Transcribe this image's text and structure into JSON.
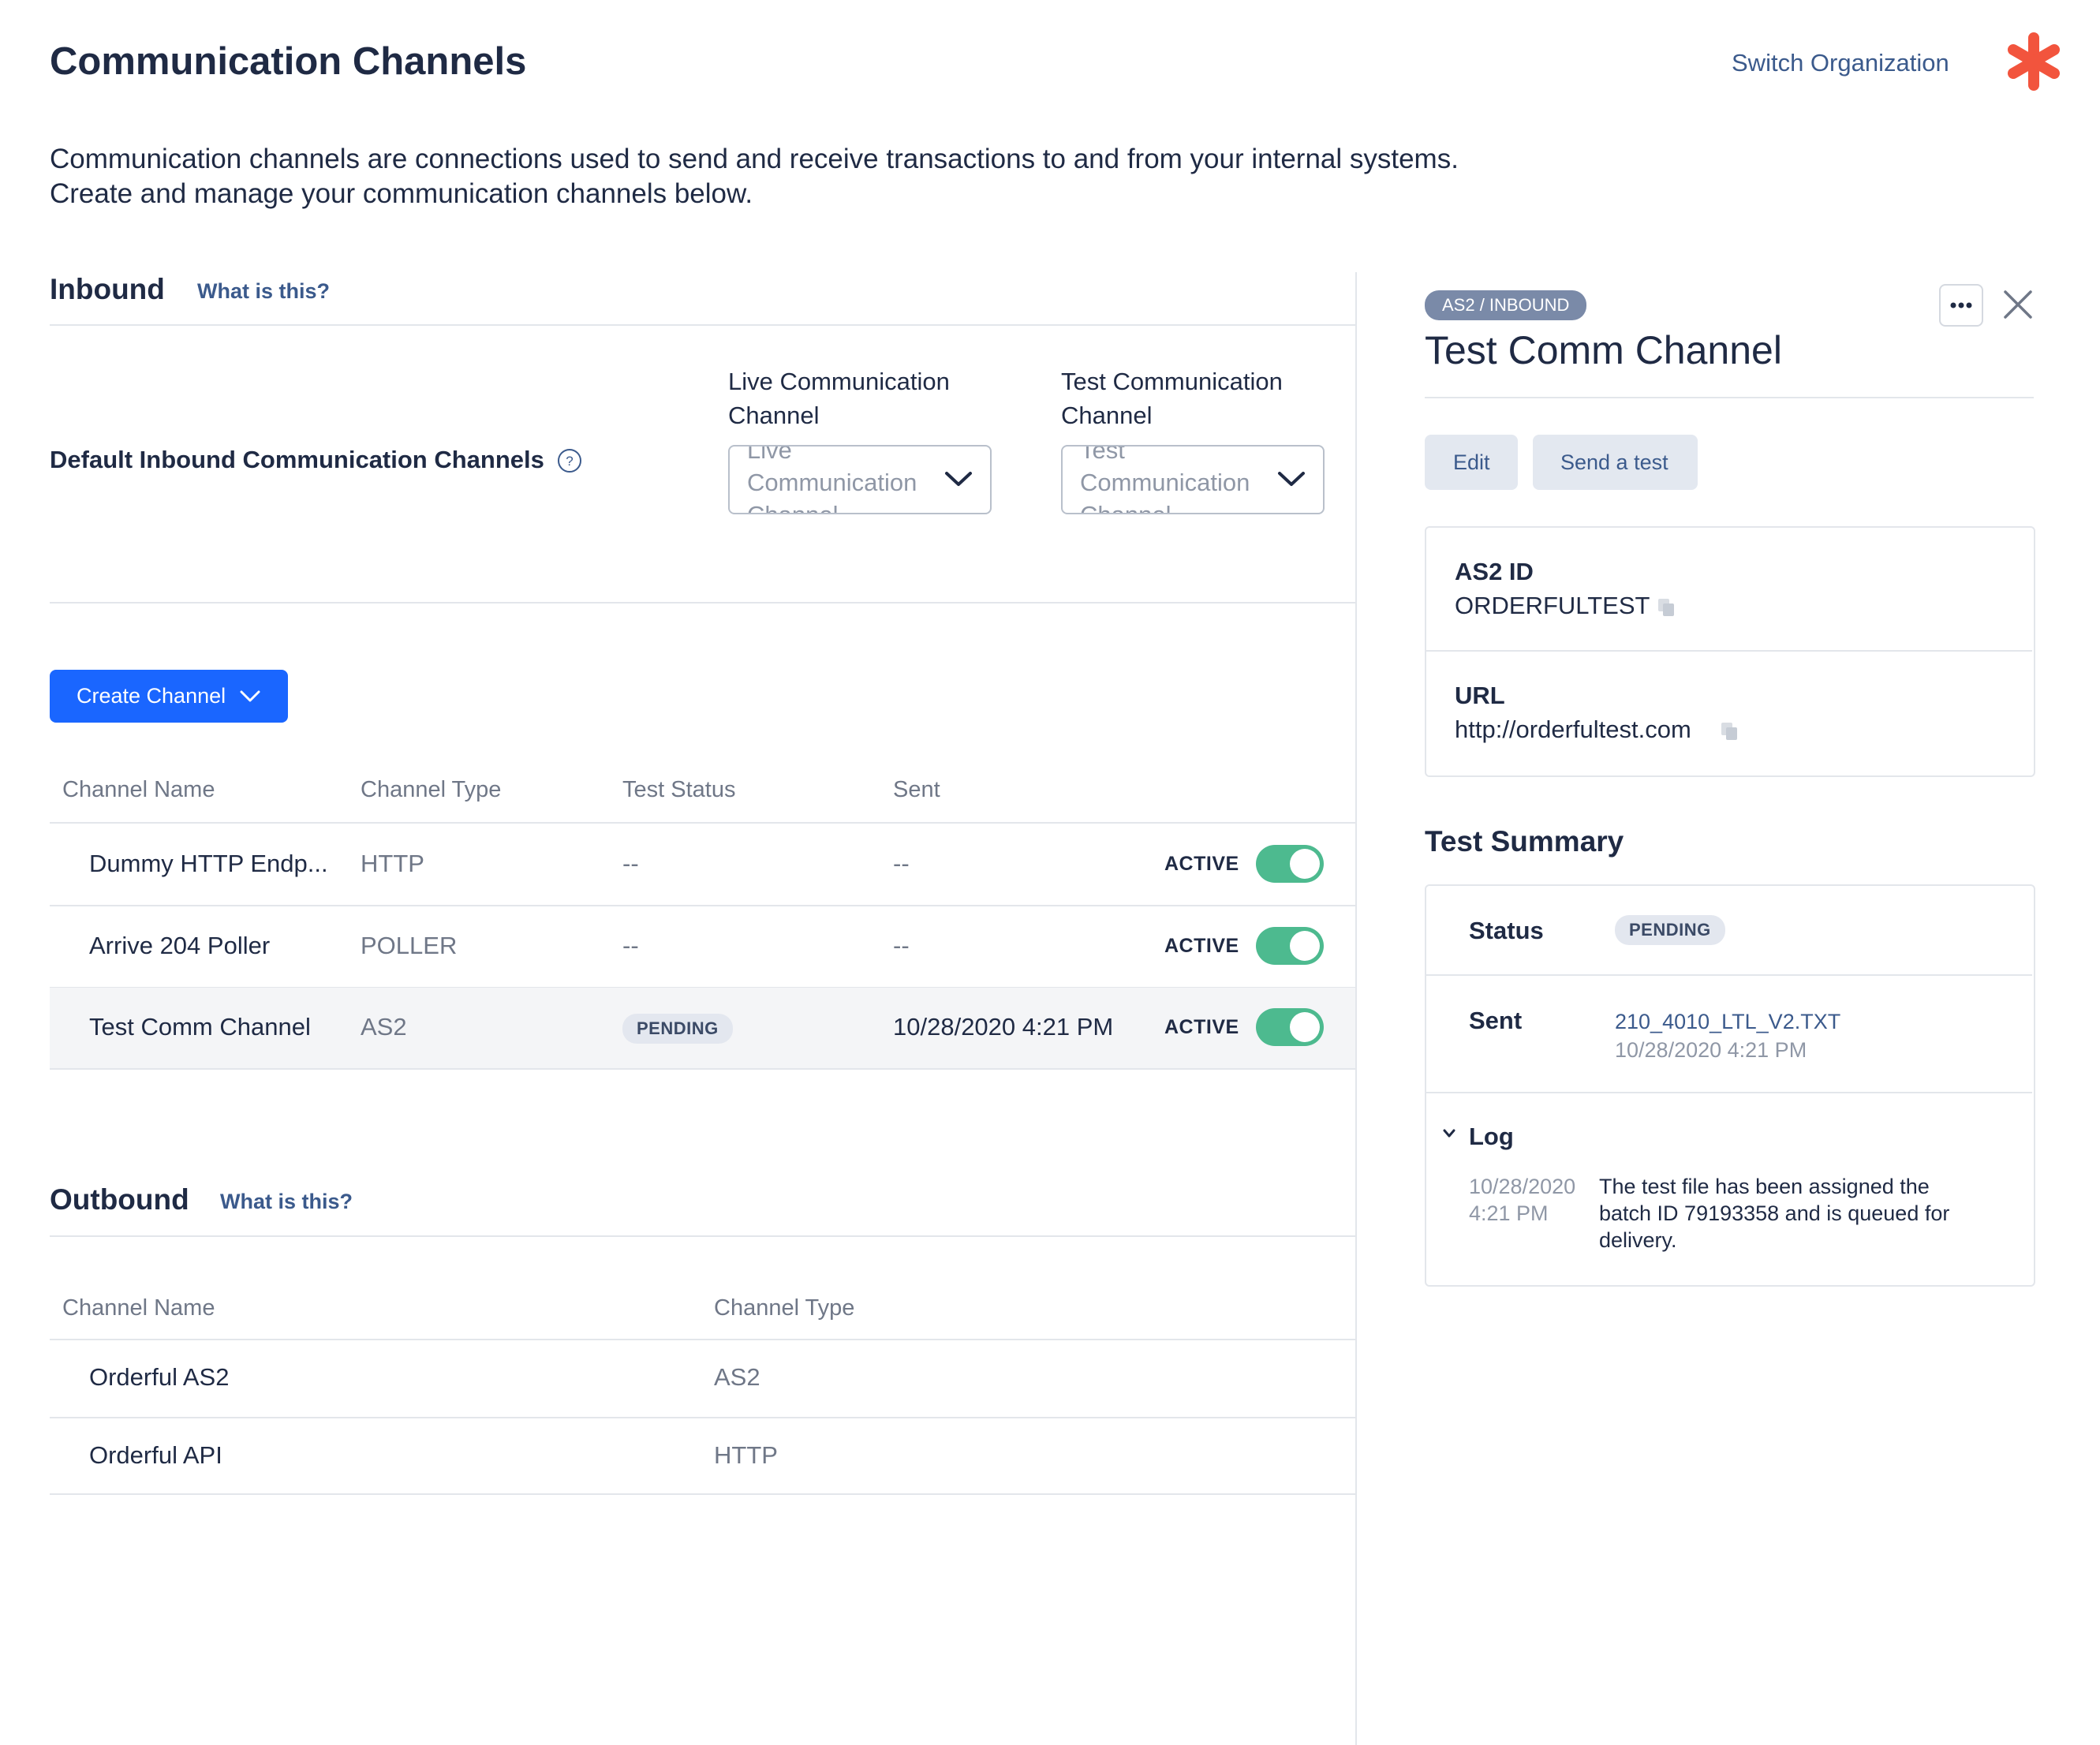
{
  "header": {
    "title": "Communication Channels",
    "switch_org": "Switch Organization"
  },
  "intro": {
    "line1": "Communication channels are connections used to send and receive transactions to and from your internal systems.",
    "line2": "Create and manage your communication channels below."
  },
  "inbound": {
    "title": "Inbound",
    "what_link": "What is this?",
    "default_label": "Default Inbound Communication Channels",
    "live_header_line1": "Live Communication",
    "live_header_line2": "Channel",
    "test_header_line1": "Test Communication",
    "test_header_line2": "Channel",
    "live_placeholder": "Live Communication Channel",
    "test_placeholder": "Test Communication Channel",
    "create_button": "Create Channel",
    "columns": [
      "Channel Name",
      "Channel Type",
      "Test Status",
      "Sent"
    ],
    "rows": [
      {
        "name": "Dummy HTTP Endp...",
        "type": "HTTP",
        "test_status": "--",
        "sent": "--",
        "state": "ACTIVE"
      },
      {
        "name": "Arrive 204 Poller",
        "type": "POLLER",
        "test_status": "--",
        "sent": "--",
        "state": "ACTIVE"
      },
      {
        "name": "Test Comm Channel",
        "type": "AS2",
        "test_status": "PENDING",
        "sent": "10/28/2020 4:21 PM",
        "state": "ACTIVE"
      }
    ]
  },
  "outbound": {
    "title": "Outbound",
    "what_link": "What is this?",
    "columns": [
      "Channel Name",
      "Channel Type"
    ],
    "rows": [
      {
        "name": "Orderful AS2",
        "type": "AS2"
      },
      {
        "name": "Orderful API",
        "type": "HTTP"
      }
    ]
  },
  "panel": {
    "tag": "AS2 / INBOUND",
    "title": "Test Comm Channel",
    "edit_button": "Edit",
    "send_test_button": "Send a test",
    "as2_id_label": "AS2 ID",
    "as2_id_value": "ORDERFULTEST",
    "url_label": "URL",
    "url_value": "http://orderfultest.com",
    "summary_title": "Test Summary",
    "status_label": "Status",
    "status_value": "PENDING",
    "sent_label": "Sent",
    "sent_file": "210_4010_LTL_V2.TXT",
    "sent_time": "10/28/2020 4:21 PM",
    "log_label": "Log",
    "log_date": "10/28/2020",
    "log_time": "4:21 PM",
    "log_line1": "The test file has been assigned the",
    "log_line2": "batch ID 79193358 and is queued for",
    "log_line3": "delivery."
  },
  "colors": {
    "primary": "#1a66ff",
    "toggle_on": "#4dba8f",
    "brand": "#f2543d",
    "link": "#3b5a8c"
  }
}
